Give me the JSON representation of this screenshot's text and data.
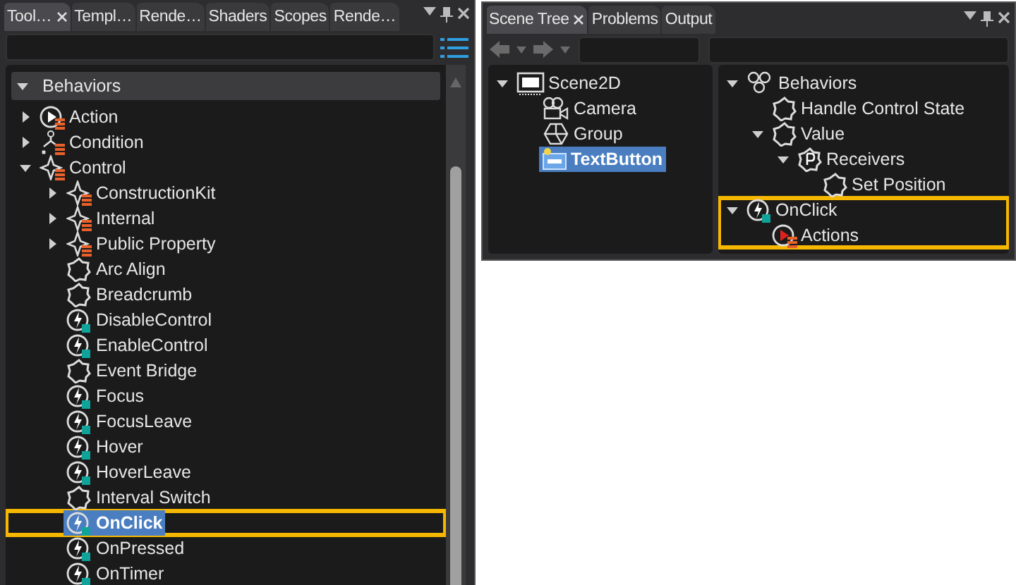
{
  "toolbox": {
    "tabs": [
      {
        "label": "Tool…",
        "selected": true
      },
      {
        "label": "Templ…",
        "selected": false
      },
      {
        "label": "Rende…",
        "selected": false
      },
      {
        "label": "Shaders",
        "selected": false
      },
      {
        "label": "Scopes",
        "selected": false
      },
      {
        "label": "Rende…",
        "selected": false
      }
    ],
    "category": {
      "label": "Behaviors",
      "expanded": true
    },
    "items": [
      {
        "label": "Action",
        "kind": "action",
        "expanded": false,
        "selected": false,
        "highlighted": false
      },
      {
        "label": "Condition",
        "kind": "condition",
        "expanded": false,
        "selected": false,
        "highlighted": false
      },
      {
        "label": "Control",
        "kind": "control",
        "expanded": true,
        "selected": false,
        "highlighted": false,
        "children": [
          {
            "label": "ConstructionKit",
            "kind": "control",
            "expanded": false,
            "selected": false,
            "highlighted": false
          },
          {
            "label": "Internal",
            "kind": "control",
            "expanded": false,
            "selected": false,
            "highlighted": false
          },
          {
            "label": "Public Property",
            "kind": "control",
            "expanded": false,
            "selected": false,
            "highlighted": false
          },
          {
            "label": "Arc Align",
            "kind": "behavior",
            "selected": false,
            "highlighted": false
          },
          {
            "label": "Breadcrumb",
            "kind": "behavior",
            "selected": false,
            "highlighted": false
          },
          {
            "label": "DisableControl",
            "kind": "event",
            "selected": false,
            "highlighted": false
          },
          {
            "label": "EnableControl",
            "kind": "event",
            "selected": false,
            "highlighted": false
          },
          {
            "label": "Event Bridge",
            "kind": "behavior",
            "selected": false,
            "highlighted": false
          },
          {
            "label": "Focus",
            "kind": "event",
            "selected": false,
            "highlighted": false
          },
          {
            "label": "FocusLeave",
            "kind": "event",
            "selected": false,
            "highlighted": false
          },
          {
            "label": "Hover",
            "kind": "event",
            "selected": false,
            "highlighted": false
          },
          {
            "label": "HoverLeave",
            "kind": "event",
            "selected": false,
            "highlighted": false
          },
          {
            "label": "Interval Switch",
            "kind": "behavior",
            "selected": false,
            "highlighted": false
          },
          {
            "label": "OnClick",
            "kind": "event",
            "selected": true,
            "highlighted": true
          },
          {
            "label": "OnPressed",
            "kind": "event",
            "selected": false,
            "highlighted": false
          },
          {
            "label": "OnTimer",
            "kind": "event",
            "selected": false,
            "highlighted": false
          }
        ]
      }
    ]
  },
  "scene_panel": {
    "tabs": [
      {
        "label": "Scene Tree",
        "selected": true
      },
      {
        "label": "Problems",
        "selected": false
      },
      {
        "label": "Output",
        "selected": false
      }
    ],
    "scene_tree": [
      {
        "label": "Scene2D",
        "kind": "scene",
        "expanded": true,
        "selected": false,
        "highlighted": false,
        "children": [
          {
            "label": "Camera",
            "kind": "camera",
            "selected": false,
            "highlighted": false
          },
          {
            "label": "Group",
            "kind": "group",
            "selected": false,
            "highlighted": false
          },
          {
            "label": "TextButton",
            "kind": "textbutton",
            "selected": true,
            "highlighted": false
          }
        ]
      }
    ],
    "behavior_tree": [
      {
        "label": "Behaviors",
        "kind": "behaviors",
        "expanded": true,
        "selected": false,
        "highlighted": false,
        "children": [
          {
            "label": "Handle Control State",
            "kind": "behavior",
            "selected": false,
            "highlighted": false
          },
          {
            "label": "Value",
            "kind": "behavior",
            "expanded": true,
            "selected": false,
            "highlighted": false,
            "children": [
              {
                "label": "Receivers",
                "kind": "property",
                "expanded": true,
                "selected": false,
                "highlighted": false,
                "children": [
                  {
                    "label": "Set Position",
                    "kind": "behavior",
                    "selected": false,
                    "highlighted": false
                  }
                ]
              }
            ]
          }
        ]
      },
      {
        "label": "OnClick",
        "kind": "event",
        "expanded": true,
        "selected": false,
        "highlighted": true,
        "children": [
          {
            "label": "Actions",
            "kind": "actions",
            "selected": false,
            "highlighted": false
          }
        ]
      }
    ]
  }
}
